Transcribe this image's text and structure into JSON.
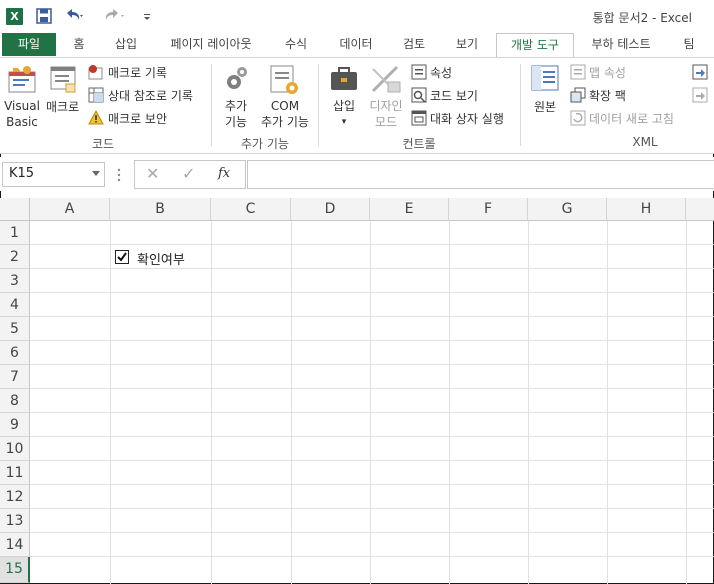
{
  "window": {
    "title": "통합 문서2 - Excel"
  },
  "quick_access": {
    "save_icon": "save-icon",
    "undo_icon": "undo-icon",
    "redo_icon": "redo-icon"
  },
  "tabs": [
    {
      "label": "파일"
    },
    {
      "label": "홈"
    },
    {
      "label": "삽입"
    },
    {
      "label": "페이지 레이아웃"
    },
    {
      "label": "수식"
    },
    {
      "label": "데이터"
    },
    {
      "label": "검토"
    },
    {
      "label": "보기"
    },
    {
      "label": "개발 도구"
    },
    {
      "label": "부하 테스트"
    },
    {
      "label": "팀"
    }
  ],
  "ribbon": {
    "code": {
      "visual_basic": "Visual\nBasic",
      "visual_basic_l1": "Visual",
      "visual_basic_l2": "Basic",
      "macros": "매크로",
      "record_macro": "매크로 기록",
      "relative_ref": "상대 참조로 기록",
      "macro_security": "매크로 보안",
      "group_label": "코드"
    },
    "addins": {
      "addins_l1": "추가",
      "addins_l2": "기능",
      "com_l1": "COM",
      "com_l2": "추가 기능",
      "group_label": "추가 기능"
    },
    "controls": {
      "insert": "삽입",
      "design_l1": "디자인",
      "design_l2": "모드",
      "properties": "속성",
      "view_code": "코드 보기",
      "run_dialog": "대화 상자 실행",
      "group_label": "컨트롤"
    },
    "xml": {
      "source": "원본",
      "map_properties": "맵 속성",
      "expansion_packs": "확장 팩",
      "refresh_data": "데이터 새로 고침",
      "group_label": "XML"
    }
  },
  "formula_bar": {
    "name_box": "K15",
    "cancel": "✕",
    "enter": "✓",
    "fx": "fx",
    "value": ""
  },
  "grid": {
    "columns": [
      "A",
      "B",
      "C",
      "D",
      "E",
      "F",
      "G",
      "H"
    ],
    "rows": [
      "1",
      "2",
      "3",
      "4",
      "5",
      "6",
      "7",
      "8",
      "9",
      "10",
      "11",
      "12",
      "13",
      "14",
      "15"
    ],
    "active_row": "15",
    "checkbox": {
      "label": "확인여부",
      "checked": true,
      "cell": "B2"
    }
  },
  "colors": {
    "accent": "#217346"
  }
}
